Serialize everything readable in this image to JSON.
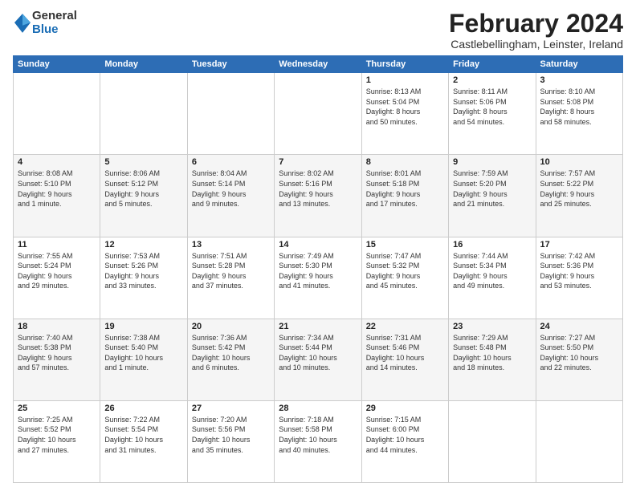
{
  "logo": {
    "general": "General",
    "blue": "Blue"
  },
  "header": {
    "title": "February 2024",
    "subtitle": "Castlebellingham, Leinster, Ireland"
  },
  "days_of_week": [
    "Sunday",
    "Monday",
    "Tuesday",
    "Wednesday",
    "Thursday",
    "Friday",
    "Saturday"
  ],
  "weeks": [
    [
      {
        "day": "",
        "info": ""
      },
      {
        "day": "",
        "info": ""
      },
      {
        "day": "",
        "info": ""
      },
      {
        "day": "",
        "info": ""
      },
      {
        "day": "1",
        "info": "Sunrise: 8:13 AM\nSunset: 5:04 PM\nDaylight: 8 hours\nand 50 minutes."
      },
      {
        "day": "2",
        "info": "Sunrise: 8:11 AM\nSunset: 5:06 PM\nDaylight: 8 hours\nand 54 minutes."
      },
      {
        "day": "3",
        "info": "Sunrise: 8:10 AM\nSunset: 5:08 PM\nDaylight: 8 hours\nand 58 minutes."
      }
    ],
    [
      {
        "day": "4",
        "info": "Sunrise: 8:08 AM\nSunset: 5:10 PM\nDaylight: 9 hours\nand 1 minute."
      },
      {
        "day": "5",
        "info": "Sunrise: 8:06 AM\nSunset: 5:12 PM\nDaylight: 9 hours\nand 5 minutes."
      },
      {
        "day": "6",
        "info": "Sunrise: 8:04 AM\nSunset: 5:14 PM\nDaylight: 9 hours\nand 9 minutes."
      },
      {
        "day": "7",
        "info": "Sunrise: 8:02 AM\nSunset: 5:16 PM\nDaylight: 9 hours\nand 13 minutes."
      },
      {
        "day": "8",
        "info": "Sunrise: 8:01 AM\nSunset: 5:18 PM\nDaylight: 9 hours\nand 17 minutes."
      },
      {
        "day": "9",
        "info": "Sunrise: 7:59 AM\nSunset: 5:20 PM\nDaylight: 9 hours\nand 21 minutes."
      },
      {
        "day": "10",
        "info": "Sunrise: 7:57 AM\nSunset: 5:22 PM\nDaylight: 9 hours\nand 25 minutes."
      }
    ],
    [
      {
        "day": "11",
        "info": "Sunrise: 7:55 AM\nSunset: 5:24 PM\nDaylight: 9 hours\nand 29 minutes."
      },
      {
        "day": "12",
        "info": "Sunrise: 7:53 AM\nSunset: 5:26 PM\nDaylight: 9 hours\nand 33 minutes."
      },
      {
        "day": "13",
        "info": "Sunrise: 7:51 AM\nSunset: 5:28 PM\nDaylight: 9 hours\nand 37 minutes."
      },
      {
        "day": "14",
        "info": "Sunrise: 7:49 AM\nSunset: 5:30 PM\nDaylight: 9 hours\nand 41 minutes."
      },
      {
        "day": "15",
        "info": "Sunrise: 7:47 AM\nSunset: 5:32 PM\nDaylight: 9 hours\nand 45 minutes."
      },
      {
        "day": "16",
        "info": "Sunrise: 7:44 AM\nSunset: 5:34 PM\nDaylight: 9 hours\nand 49 minutes."
      },
      {
        "day": "17",
        "info": "Sunrise: 7:42 AM\nSunset: 5:36 PM\nDaylight: 9 hours\nand 53 minutes."
      }
    ],
    [
      {
        "day": "18",
        "info": "Sunrise: 7:40 AM\nSunset: 5:38 PM\nDaylight: 9 hours\nand 57 minutes."
      },
      {
        "day": "19",
        "info": "Sunrise: 7:38 AM\nSunset: 5:40 PM\nDaylight: 10 hours\nand 1 minute."
      },
      {
        "day": "20",
        "info": "Sunrise: 7:36 AM\nSunset: 5:42 PM\nDaylight: 10 hours\nand 6 minutes."
      },
      {
        "day": "21",
        "info": "Sunrise: 7:34 AM\nSunset: 5:44 PM\nDaylight: 10 hours\nand 10 minutes."
      },
      {
        "day": "22",
        "info": "Sunrise: 7:31 AM\nSunset: 5:46 PM\nDaylight: 10 hours\nand 14 minutes."
      },
      {
        "day": "23",
        "info": "Sunrise: 7:29 AM\nSunset: 5:48 PM\nDaylight: 10 hours\nand 18 minutes."
      },
      {
        "day": "24",
        "info": "Sunrise: 7:27 AM\nSunset: 5:50 PM\nDaylight: 10 hours\nand 22 minutes."
      }
    ],
    [
      {
        "day": "25",
        "info": "Sunrise: 7:25 AM\nSunset: 5:52 PM\nDaylight: 10 hours\nand 27 minutes."
      },
      {
        "day": "26",
        "info": "Sunrise: 7:22 AM\nSunset: 5:54 PM\nDaylight: 10 hours\nand 31 minutes."
      },
      {
        "day": "27",
        "info": "Sunrise: 7:20 AM\nSunset: 5:56 PM\nDaylight: 10 hours\nand 35 minutes."
      },
      {
        "day": "28",
        "info": "Sunrise: 7:18 AM\nSunset: 5:58 PM\nDaylight: 10 hours\nand 40 minutes."
      },
      {
        "day": "29",
        "info": "Sunrise: 7:15 AM\nSunset: 6:00 PM\nDaylight: 10 hours\nand 44 minutes."
      },
      {
        "day": "",
        "info": ""
      },
      {
        "day": "",
        "info": ""
      }
    ]
  ]
}
